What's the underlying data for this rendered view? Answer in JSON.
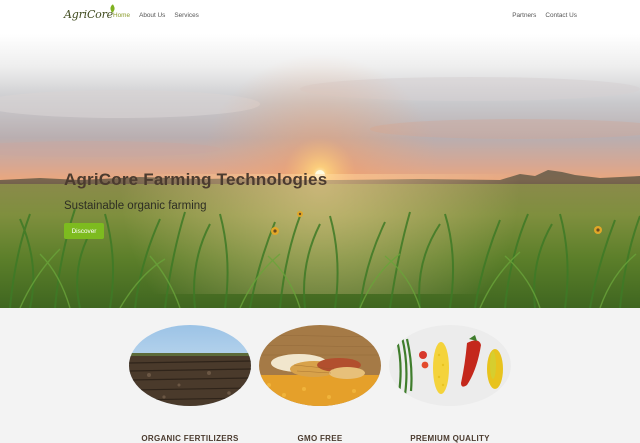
{
  "brand": {
    "name": "AgriCore"
  },
  "nav": {
    "left": [
      {
        "label": "Home",
        "active": true
      },
      {
        "label": "About Us",
        "active": false
      },
      {
        "label": "Services",
        "active": false
      }
    ],
    "right": [
      {
        "label": "Partners"
      },
      {
        "label": "Contact Us"
      }
    ]
  },
  "hero": {
    "title": "AgriCore Farming Technologies",
    "subtitle": "Sustainable organic farming",
    "cta_label": "Discover"
  },
  "features": [
    {
      "caption": "ORGANIC FERTILIZERS",
      "image": "plowed-field"
    },
    {
      "caption": "GMO FREE",
      "image": "corn-cobs"
    },
    {
      "caption": "PREMIUM QUALITY",
      "image": "vegetables"
    }
  ],
  "colors": {
    "accent": "#7dbb1f",
    "nav_active": "#8a9b2a",
    "heading": "#4b3b2f"
  }
}
